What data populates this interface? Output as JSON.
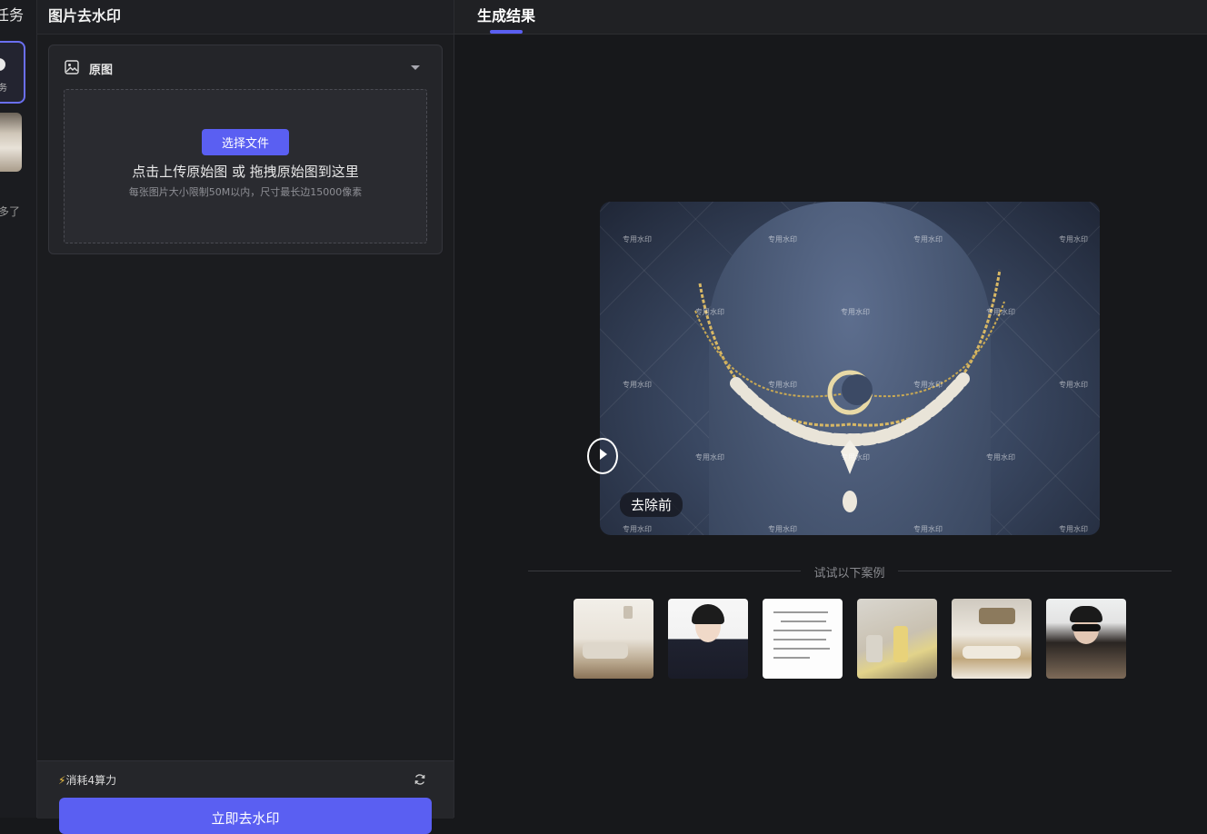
{
  "sidebar": {
    "title": "任务",
    "active_task_label": "务",
    "more_label": "多了"
  },
  "settings": {
    "title": "图片去水印",
    "original": {
      "label": "原图",
      "select_button": "选择文件",
      "upload_hint": "点击上传原始图 或 拖拽原始图到这里",
      "limit_hint": "每张图片大小限制50M以内，尺寸最长边15000像素"
    },
    "footer": {
      "cost_text": "消耗4算力",
      "submit_button": "立即去水印"
    }
  },
  "result": {
    "tab_title": "生成结果",
    "preview_label": "去除前",
    "watermark_text": "专用水印",
    "examples_heading": "试试以下案例",
    "examples": [
      {
        "name": "living-room"
      },
      {
        "name": "portrait-woman"
      },
      {
        "name": "document"
      },
      {
        "name": "cosmetics"
      },
      {
        "name": "interior"
      },
      {
        "name": "portrait-man"
      }
    ]
  },
  "colors": {
    "accent": "#5a5ff2",
    "background": "#17181b",
    "panel": "#1b1c1f"
  }
}
